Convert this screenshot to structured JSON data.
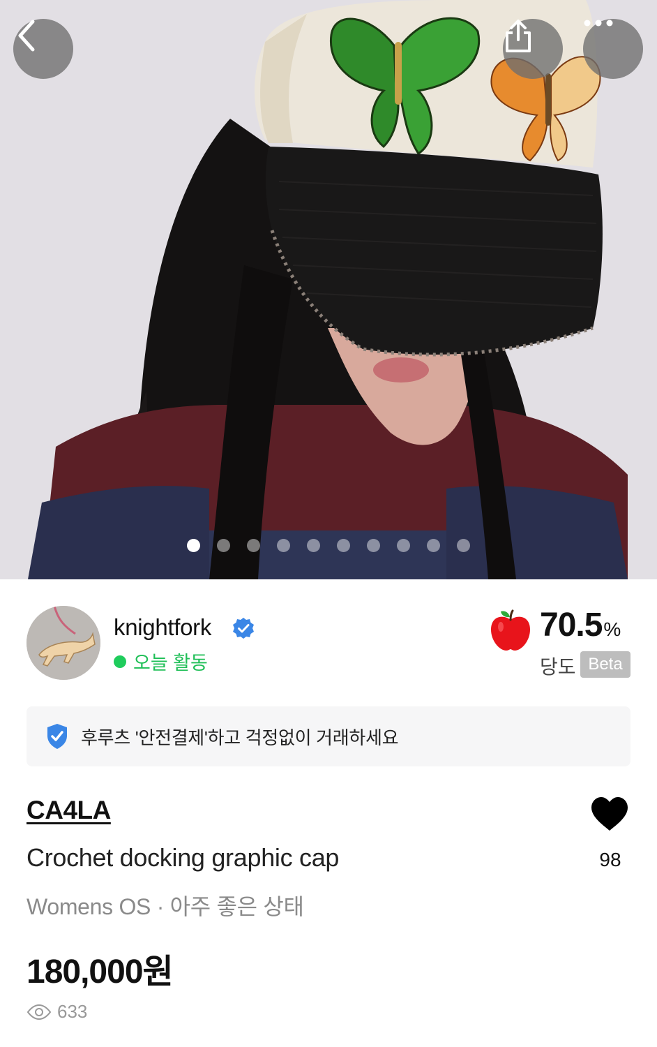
{
  "nav": {
    "back_icon": "chevron-left-icon",
    "share_icon": "share-icon",
    "more_icon": "more-dots-icon"
  },
  "gallery": {
    "total_images": 10,
    "active_index": 0
  },
  "seller": {
    "name": "knightfork",
    "verified": true,
    "activity": "오늘 활동"
  },
  "sweetness": {
    "value": "70.5",
    "unit": "%",
    "label": "당도",
    "badge": "Beta"
  },
  "safe_pay": {
    "text": "후루츠 '안전결제'하고 걱정없이 거래하세요"
  },
  "product": {
    "brand": "CA4LA",
    "title": "Crochet docking graphic cap",
    "meta": "Womens OS · 아주 좋은 상태",
    "price": "180,000원",
    "views": "633",
    "likes": "98"
  },
  "colors": {
    "online_green": "#1fcc5c",
    "verified_blue": "#3a86e6",
    "apple_red": "#e8141b",
    "beta_gray": "#bdbdbd"
  }
}
